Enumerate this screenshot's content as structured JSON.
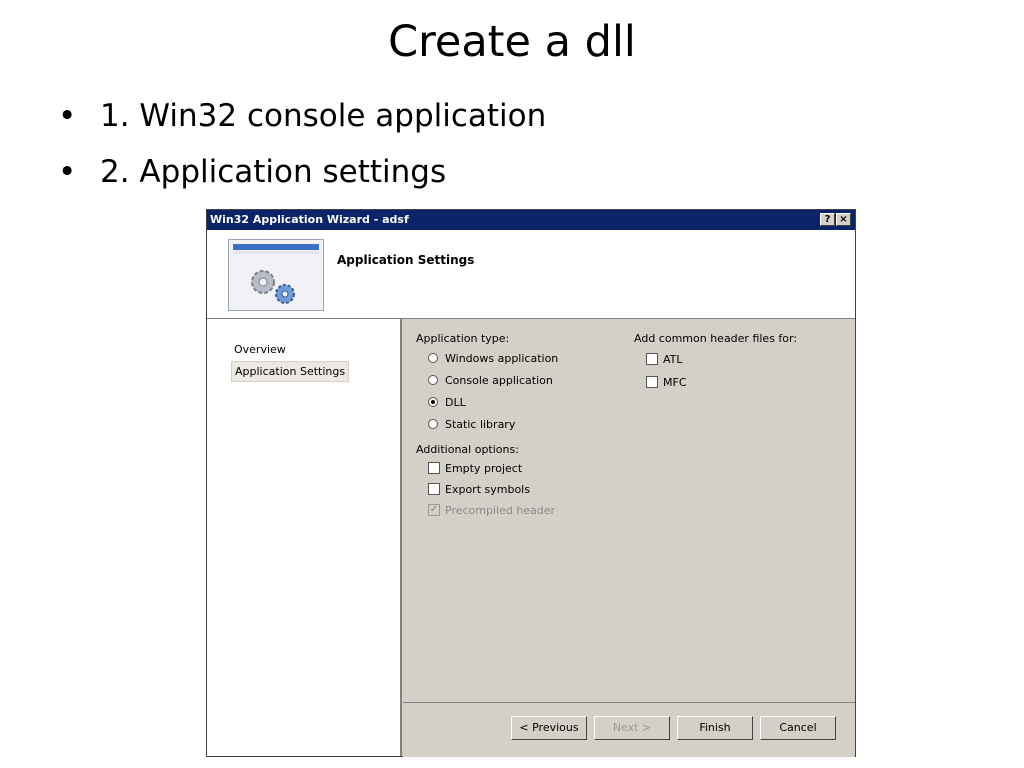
{
  "slide": {
    "title": "Create a dll",
    "bullet_char": "•",
    "bullets": [
      "1. Win32 console application",
      "2. Application settings"
    ]
  },
  "dialog": {
    "title": "Win32 Application Wizard - adsf",
    "help_button": "?",
    "close_button": "×",
    "header_title": "Application Settings",
    "nav": [
      "Overview",
      "Application Settings"
    ],
    "application_type": {
      "label": "Application type:",
      "options": [
        {
          "label": "Windows application",
          "accel": "W",
          "selected": false
        },
        {
          "label": "Console application",
          "accel": "o",
          "selected": false
        },
        {
          "label": "DLL",
          "accel": "D",
          "selected": true
        },
        {
          "label": "Static library",
          "accel": "S",
          "selected": false
        }
      ]
    },
    "additional_options": {
      "label": "Additional options:",
      "options": [
        {
          "label": "Empty project",
          "checked": false,
          "enabled": true
        },
        {
          "label": "Export symbols",
          "checked": false,
          "enabled": true
        },
        {
          "label": "Precompiled header",
          "checked": true,
          "enabled": false
        }
      ]
    },
    "common_headers": {
      "label": "Add common header files for:",
      "options": [
        {
          "label": "ATL",
          "checked": false
        },
        {
          "label": "MFC",
          "checked": false
        }
      ]
    },
    "buttons": {
      "previous": "< Previous",
      "next": "Next >",
      "finish": "Finish",
      "cancel": "Cancel"
    }
  },
  "colors": {
    "titlebar": "#0a246a",
    "dialog_bg": "#d4d0c8"
  }
}
